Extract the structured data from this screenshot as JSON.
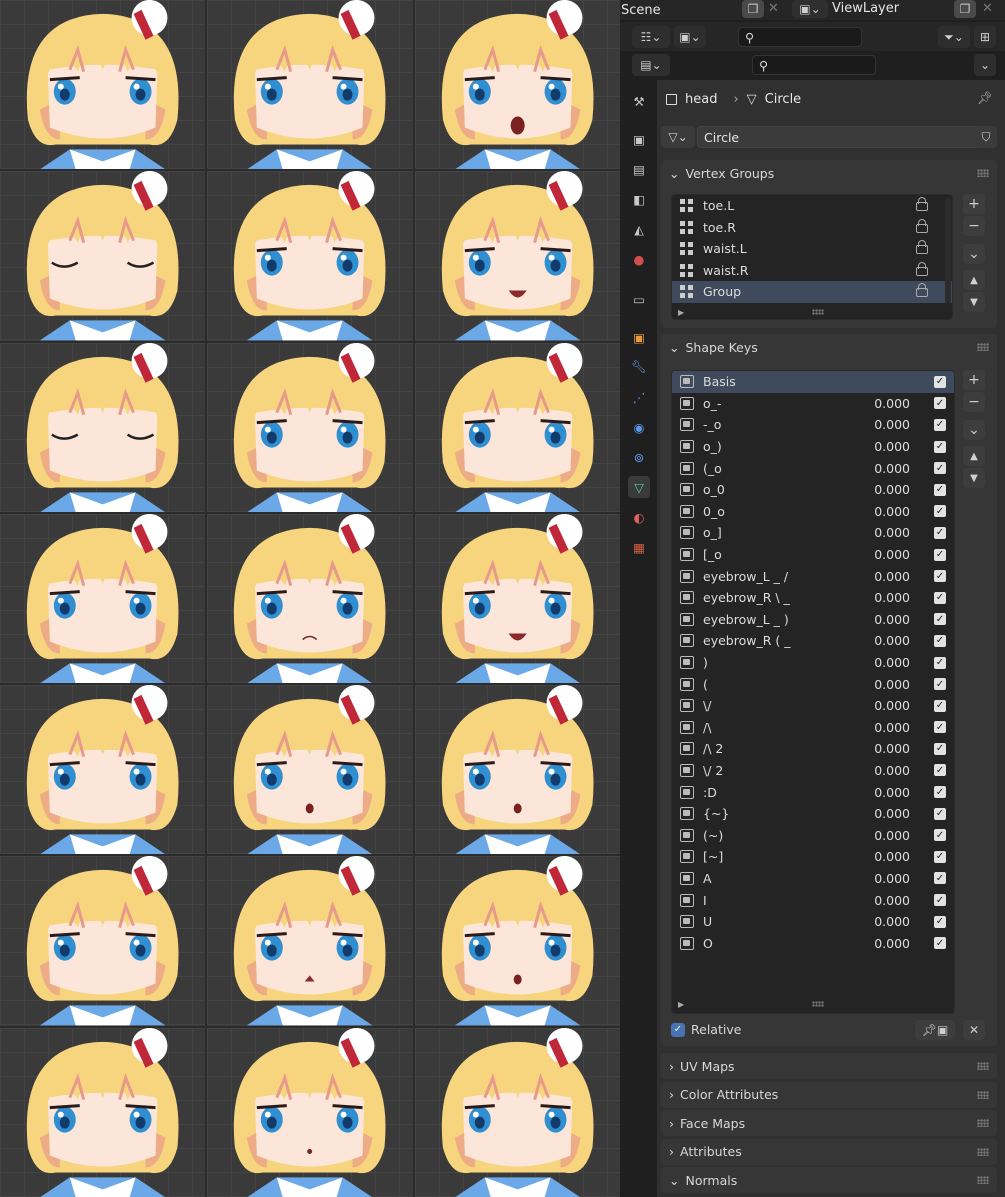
{
  "header": {
    "scene_label": "Scene",
    "viewlayer_label": "ViewLayer"
  },
  "breadcrumb": {
    "object": "head",
    "mesh": "Circle"
  },
  "mesh_name": "Circle",
  "vertex_groups": {
    "title": "Vertex Groups",
    "items": [
      "toe.L",
      "toe.R",
      "waist.L",
      "waist.R",
      "Group"
    ],
    "selected": "Group"
  },
  "shape_keys": {
    "title": "Shape Keys",
    "items": [
      {
        "name": "Basis",
        "value": ""
      },
      {
        "name": "o_-",
        "value": "0.000"
      },
      {
        "name": "-_o",
        "value": "0.000"
      },
      {
        "name": "o_)",
        "value": "0.000"
      },
      {
        "name": "(_o",
        "value": "0.000"
      },
      {
        "name": "o_0",
        "value": "0.000"
      },
      {
        "name": "0_o",
        "value": "0.000"
      },
      {
        "name": "o_]",
        "value": "0.000"
      },
      {
        "name": "[_o",
        "value": "0.000"
      },
      {
        "name": "eyebrow_L _ /",
        "value": "0.000"
      },
      {
        "name": "eyebrow_R \\ _",
        "value": "0.000"
      },
      {
        "name": "eyebrow_L _ )",
        "value": "0.000"
      },
      {
        "name": "eyebrow_R ( _",
        "value": "0.000"
      },
      {
        "name": ")",
        "value": "0.000"
      },
      {
        "name": "(",
        "value": "0.000"
      },
      {
        "name": "\\/",
        "value": "0.000"
      },
      {
        "name": "/\\",
        "value": "0.000"
      },
      {
        "name": "/\\ 2",
        "value": "0.000"
      },
      {
        "name": "\\/ 2",
        "value": "0.000"
      },
      {
        "name": ":D",
        "value": "0.000"
      },
      {
        "name": "{~}",
        "value": "0.000"
      },
      {
        "name": "(~)",
        "value": "0.000"
      },
      {
        "name": "[~]",
        "value": "0.000"
      },
      {
        "name": "A",
        "value": "0.000"
      },
      {
        "name": "I",
        "value": "0.000"
      },
      {
        "name": "U",
        "value": "0.000"
      },
      {
        "name": "O",
        "value": "0.000"
      }
    ],
    "selected": "Basis",
    "relative_label": "Relative"
  },
  "collapsed_sections": [
    "UV Maps",
    "Color Attributes",
    "Face Maps",
    "Attributes",
    "Normals"
  ],
  "colors": {
    "hair": "#f7d57e",
    "hair_shadow": "#e89a8a",
    "eye": "#2f8fd0",
    "skin": "#fbe6d9",
    "collar": "#6aa8e8",
    "hat_ribbon": "#c0283a",
    "selected_row": "#3f4b5c",
    "accent": "#4772b3"
  }
}
